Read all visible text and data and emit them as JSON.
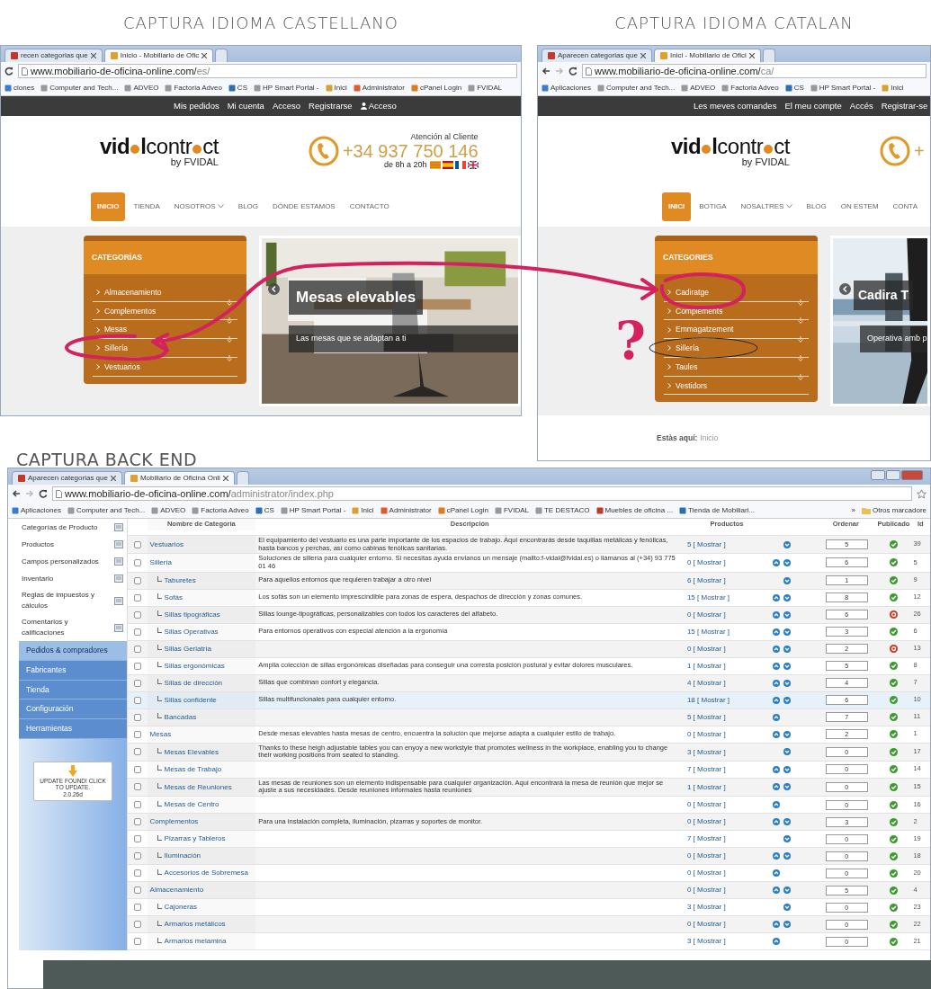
{
  "captures": [
    {
      "heading": "CAPTURA IDIOMA CASTELLANO",
      "browser": {
        "tabs": [
          {
            "label": "recen categorias que",
            "selected": false
          },
          {
            "label": "Inicio - Mobiliario de Ofic",
            "selected": true
          }
        ],
        "nav_buttons": [
          {
            "kind": "reload",
            "disabled": false
          }
        ],
        "url": "www.mobiliario-de-oficina-online.com/",
        "url_path": "es/",
        "bookmarks": [
          "ciones",
          "Computer and Tech...",
          "ADVEO",
          "Factoria Adveo",
          "CS",
          "HP Smart Portal -",
          "Inici",
          "Administrator",
          "cPanel Login",
          "FVIDAL"
        ]
      },
      "site": {
        "top_links": [
          "Mis pedidos",
          "Mi cuenta",
          "Acceso",
          "Registrarse",
          "Acceso"
        ],
        "logo": [
          {
            "kind": "text",
            "text": "vid",
            "bold": true
          },
          {
            "kind": "dot"
          },
          {
            "kind": "text",
            "text": "l",
            "bold": true
          },
          {
            "kind": "text",
            "text": "contr",
            "bold": false
          },
          {
            "kind": "dot"
          },
          {
            "kind": "text",
            "text": "ct",
            "bold": false
          }
        ],
        "logo_tagline": "by FVIDAL",
        "phone": {
          "label": "Atención al Cliente",
          "number": "+34 937 750 146",
          "hours": "de 8h a 20h"
        },
        "menu": [
          {
            "label": "INICIO",
            "selected": true,
            "dropdown": false
          },
          {
            "label": "TIENDA",
            "selected": false,
            "dropdown": false
          },
          {
            "label": "NOSOTROS",
            "selected": false,
            "dropdown": true
          },
          {
            "label": "BLOG",
            "selected": false,
            "dropdown": false
          },
          {
            "label": "DÓNDE ESTAMOS",
            "selected": false,
            "dropdown": false
          },
          {
            "label": "CONTACTO",
            "selected": false,
            "dropdown": false
          }
        ],
        "categories_title": "CATEGORÍAS",
        "categories": [
          {
            "label": "Almacenamiento",
            "expandable": false
          },
          {
            "label": "Complementos",
            "expandable": true
          },
          {
            "label": "Mesas",
            "expandable": true
          },
          {
            "label": "Sillería",
            "expandable": true
          },
          {
            "label": "Vestuarios",
            "expandable": true
          }
        ],
        "slide": {
          "title": "Mesas elevables",
          "caption": "Las mesas que se adaptan a ti"
        }
      }
    },
    {
      "heading": "CAPTURA IDIOMA CATALAN",
      "browser": {
        "tabs": [
          {
            "label": "Aparecen categorias que",
            "selected": false
          },
          {
            "label": "Inici - Mobiliario de Ofici",
            "selected": true
          }
        ],
        "nav_buttons": [
          {
            "kind": "back",
            "disabled": false
          },
          {
            "kind": "forward",
            "disabled": true
          },
          {
            "kind": "reload",
            "disabled": false
          }
        ],
        "url": "www.mobiliario-de-oficina-online.com/",
        "url_path": "ca/",
        "bookmarks": [
          "Aplicaciones",
          "Computer and Tech...",
          "ADVEO",
          "Factoria Adveo",
          "CS",
          "HP Smart Portal -",
          "Inici"
        ]
      },
      "site": {
        "top_links": [
          "Les meves comandes",
          "El meu compte",
          "Accés",
          "Registrar-se"
        ],
        "logo": [
          {
            "kind": "text",
            "text": "vid",
            "bold": true
          },
          {
            "kind": "dot"
          },
          {
            "kind": "text",
            "text": "l",
            "bold": true
          },
          {
            "kind": "text",
            "text": "contr",
            "bold": false
          },
          {
            "kind": "dot"
          },
          {
            "kind": "text",
            "text": "ct",
            "bold": false
          }
        ],
        "logo_tagline": "by FVIDAL",
        "phone": {
          "number": "+"
        },
        "menu": [
          {
            "label": "INICI",
            "selected": true,
            "dropdown": false
          },
          {
            "label": "BOTIGA",
            "selected": false,
            "dropdown": false
          },
          {
            "label": "NOSALTRES",
            "selected": false,
            "dropdown": true
          },
          {
            "label": "BLOG",
            "selected": false,
            "dropdown": false
          },
          {
            "label": "ON ESTEM",
            "selected": false,
            "dropdown": false
          },
          {
            "label": "CONTA",
            "selected": false,
            "dropdown": false
          }
        ],
        "categories_title": "CATEGORIES",
        "categories": [
          {
            "label": "Cadiratge",
            "expandable": false
          },
          {
            "label": "Complements",
            "expandable": true
          },
          {
            "label": "Emmagatzement",
            "expandable": true
          },
          {
            "label": "Sillería",
            "expandable": true
          },
          {
            "label": "Taules",
            "expandable": true
          },
          {
            "label": "Vestidors",
            "expandable": true
          }
        ],
        "slide": {
          "title": "Cadira T",
          "caption": "Operativa amb p"
        },
        "breadcrumb": {
          "label": "Estàs aquí:",
          "current": "Inicio"
        }
      }
    }
  ],
  "backend": {
    "heading": "CAPTURA BACK END",
    "browser": {
      "tabs": [
        {
          "label": "Aparecen categorias que",
          "selected": false
        },
        {
          "label": "Mobiliario de Oficina Onli",
          "selected": true
        }
      ],
      "nav_buttons": [
        {
          "kind": "back",
          "disabled": false
        },
        {
          "kind": "forward",
          "disabled": true
        },
        {
          "kind": "reload",
          "disabled": false
        }
      ],
      "url": "www.mobiliario-de-oficina-online.com/",
      "url_path": "administrator/index.php",
      "bookmarks": [
        "Aplicaciones",
        "Computer and Tech...",
        "ADVEO",
        "Factoria Adveo",
        "CS",
        "HP Smart Portal -",
        "Inici",
        "Administrator",
        "cPanel Login",
        "FVIDAL",
        "TE DESTACO",
        "Muebles de oficina ...",
        "Tienda de Mobiliari..."
      ],
      "more": "»",
      "other_bookmarks": "Otros marcadore"
    },
    "sidebar": {
      "items": [
        "Categorías de Producto",
        "Productos",
        "Campos personalizados",
        "Inventario",
        "Reglas de impuestos y cálculos",
        "Comentarios y calificaciones"
      ],
      "sections": [
        {
          "label": "Pedidos & compradores",
          "selected": true
        },
        {
          "label": "Fabricantes",
          "selected": false
        },
        {
          "label": "Tienda",
          "selected": false
        },
        {
          "label": "Configuración",
          "selected": false
        },
        {
          "label": "Herramientas",
          "selected": false
        }
      ],
      "update": {
        "message": "UPDATE FOUND! CLICK TO UPDATE.",
        "version": "2.0.26d"
      }
    },
    "columns": [
      "Nombre de Categoría",
      "Descripción",
      "Productos",
      "Ordenar",
      "Publicado",
      "Id"
    ],
    "rows": [
      {
        "name": "Vestuarios",
        "description": "El equipamiento del vestuario es una parte importante de los espacios de trabajo. Aquí encontrarás desde taquillas metálicas y fenólicas, hasta bancos y perchas, así como cabinas fenólicas sanitarias.",
        "products": "5",
        "show": "[ Mostrar ]",
        "up": false,
        "down": true,
        "order": "5",
        "published": true,
        "id": "39",
        "selected": false
      },
      {
        "name": "Sillería",
        "description": "Soluciones de sillería para cualquier entorno. Si necesitas ayuda envianos un mensaje (mailto:f-vidal@fvidal.es) o llámanos al (+34) 93 775 01 46",
        "products": "0",
        "show": "[ Mostrar ]",
        "up": true,
        "down": true,
        "order": "6",
        "published": true,
        "id": "5",
        "selected": false,
        "children": [
          {
            "name": "Taburetes",
            "description": "Para aquellos entornos que requieren trabajar a otro nivel",
            "products": "6",
            "show": "[ Mostrar ]",
            "up": false,
            "down": true,
            "order": "1",
            "published": true,
            "id": "9",
            "selected": false
          },
          {
            "name": "Sofás",
            "description": "Los sofás son un elemento imprescindible para zonas de espera, despachos de dirección y zonas comunes.",
            "products": "15",
            "show": "[ Mostrar ]",
            "up": true,
            "down": true,
            "order": "8",
            "published": true,
            "id": "12",
            "selected": false
          },
          {
            "name": "Sillas tipográficas",
            "description": "Sillas lounge-tipográficas, personalizables con todos los caracteres del alfabeto.",
            "products": "0",
            "show": "[ Mostrar ]",
            "up": true,
            "down": true,
            "order": "6",
            "published": false,
            "id": "26",
            "selected": false
          },
          {
            "name": "Sillas Operativas",
            "description": "Para entornos operativos con especial atención a la ergonomía",
            "products": "15",
            "show": "[ Mostrar ]",
            "up": true,
            "down": true,
            "order": "3",
            "published": true,
            "id": "6",
            "selected": false
          },
          {
            "name": "Sillas Geriatría",
            "products": "0",
            "show": "[ Mostrar ]",
            "up": true,
            "down": true,
            "order": "2",
            "published": false,
            "id": "13",
            "selected": false
          },
          {
            "name": "Sillas ergonómicas",
            "description": "Amplia colección de sillas ergonómicas diseñadas para conseguir una corresta posición postural y evitar dolores musculares.",
            "products": "1",
            "show": "[ Mostrar ]",
            "up": true,
            "down": true,
            "order": "5",
            "published": true,
            "id": "8",
            "selected": false
          },
          {
            "name": "Sillas de dirección",
            "description": "Sillas que combinan confort y elegancia.",
            "products": "4",
            "show": "[ Mostrar ]",
            "up": true,
            "down": true,
            "order": "4",
            "published": true,
            "id": "7",
            "selected": false
          },
          {
            "name": "Sillas confidente",
            "description": "Sillas multifuncionales para cualquier entorno.",
            "products": "18",
            "show": "[ Mostrar ]",
            "up": true,
            "down": true,
            "order": "6",
            "published": true,
            "id": "10",
            "selected": true
          },
          {
            "name": "Bancadas",
            "products": "5",
            "show": "[ Mostrar ]",
            "up": true,
            "down": false,
            "order": "7",
            "published": true,
            "id": "11",
            "selected": false
          }
        ]
      },
      {
        "name": "Mesas",
        "description": "Desde mesas elevables hasta mesas de centro, encuentra la solución que mejorse adapta a cualquier estilo de trabajo.",
        "products": "0",
        "show": "[ Mostrar ]",
        "up": true,
        "down": true,
        "order": "2",
        "published": true,
        "id": "1",
        "selected": false,
        "children": [
          {
            "name": "Mesas Elevables",
            "description": "Thanks to these heigh adjustable tables you can enyoy a new workstyle that promotes wellness in the workplace, enabling you to change their working positions from seated to standing.",
            "products": "3",
            "show": "[ Mostrar ]",
            "up": false,
            "down": true,
            "order": "0",
            "published": true,
            "id": "17",
            "selected": false
          },
          {
            "name": "Mesas de Trabajo",
            "products": "7",
            "show": "[ Mostrar ]",
            "up": true,
            "down": true,
            "order": "0",
            "published": true,
            "id": "14",
            "selected": false
          },
          {
            "name": "Mesas de Reuniones",
            "description": "Las mesas de reuniones son un elemento indispensable para cualquier organización. Aquí encontrará la mesa de reunión que mejor se ajuste a sus necesidades. Desde reuniones informales hasta reuniones",
            "products": "1",
            "show": "[ Mostrar ]",
            "up": true,
            "down": true,
            "order": "0",
            "published": true,
            "id": "15",
            "selected": false
          },
          {
            "name": "Mesas de Centro",
            "products": "0",
            "show": "[ Mostrar ]",
            "up": true,
            "down": false,
            "order": "0",
            "published": true,
            "id": "16",
            "selected": false
          }
        ]
      },
      {
        "name": "Complementos",
        "description": "Para una instalación completa, iluminación, pizarras y soportes de monitor.",
        "products": "0",
        "show": "[ Mostrar ]",
        "up": true,
        "down": true,
        "order": "3",
        "published": true,
        "id": "2",
        "selected": false,
        "children": [
          {
            "name": "Pizarras y Tableros",
            "products": "7",
            "show": "[ Mostrar ]",
            "up": false,
            "down": true,
            "order": "0",
            "published": true,
            "id": "19",
            "selected": false
          },
          {
            "name": "Iluminación",
            "products": "0",
            "show": "[ Mostrar ]",
            "up": true,
            "down": true,
            "order": "0",
            "published": true,
            "id": "18",
            "selected": false
          },
          {
            "name": "Accesorios de Sobremesa",
            "products": "0",
            "show": "[ Mostrar ]",
            "up": true,
            "down": false,
            "order": "0",
            "published": true,
            "id": "20",
            "selected": false
          }
        ]
      },
      {
        "name": "Almacenamiento",
        "products": "0",
        "show": "[ Mostrar ]",
        "up": true,
        "down": true,
        "order": "5",
        "published": true,
        "id": "4",
        "selected": false,
        "children": [
          {
            "name": "Cajoneras",
            "products": "3",
            "show": "[ Mostrar ]",
            "up": false,
            "down": true,
            "order": "0",
            "published": true,
            "id": "23",
            "selected": false
          },
          {
            "name": "Armarios metálicos",
            "products": "0",
            "show": "[ Mostrar ]",
            "up": true,
            "down": true,
            "order": "0",
            "published": true,
            "id": "22",
            "selected": false
          },
          {
            "name": "Armarios melamina",
            "products": "3",
            "show": "[ Mostrar ]",
            "up": true,
            "down": false,
            "order": "0",
            "published": true,
            "id": "21",
            "selected": false
          }
        ]
      }
    ]
  },
  "annotation": {
    "question_mark": "?"
  }
}
